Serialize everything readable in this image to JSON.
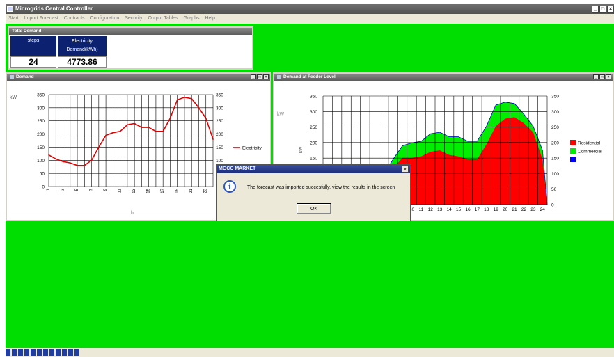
{
  "window": {
    "title": "Microgrids Central Controller",
    "controls": [
      "_",
      "□",
      "×"
    ]
  },
  "menu": [
    "Start",
    "Import Forecast",
    "Contracts",
    "Configuration",
    "Security",
    "Output Tables",
    "Graphs",
    "Help"
  ],
  "total_demand": {
    "title": "Total Demand",
    "col1_header": "steps",
    "col2_header": "Electricity Demand(kWh)",
    "steps_value": "24",
    "demand_value": "4773.86"
  },
  "demand_panel": {
    "title": "Demand",
    "unit_label": "kW",
    "x_label": "h",
    "legend": "Electricity",
    "chart_data": {
      "type": "line",
      "x": [
        1,
        2,
        3,
        4,
        5,
        6,
        7,
        8,
        9,
        10,
        11,
        12,
        13,
        14,
        15,
        16,
        17,
        18,
        19,
        20,
        21,
        22,
        23,
        24
      ],
      "series": [
        {
          "name": "Electricity",
          "values": [
            120,
            105,
            95,
            90,
            80,
            80,
            100,
            150,
            195,
            205,
            210,
            235,
            240,
            225,
            225,
            210,
            210,
            260,
            330,
            340,
            335,
            300,
            260,
            180
          ]
        }
      ],
      "ylim": [
        0,
        350
      ],
      "yticks": [
        0,
        50,
        100,
        150,
        200,
        250,
        300,
        350
      ],
      "xticks": [
        "1",
        "3",
        "5",
        "7",
        "9",
        "11",
        "13",
        "15",
        "17",
        "19",
        "21",
        "23"
      ],
      "grid": true,
      "legend": "right"
    }
  },
  "feeder_panel": {
    "title": "Demand at Feeder Level",
    "unit_label": "kW",
    "legend": [
      "Residential",
      "Commercial",
      ""
    ],
    "colors": {
      "residential": "#ff0000",
      "commercial": "#00ee00",
      "other": "#0000ff"
    },
    "chart_data": {
      "type": "area",
      "x": [
        1,
        2,
        3,
        4,
        5,
        6,
        7,
        8,
        9,
        10,
        11,
        12,
        13,
        14,
        15,
        16,
        17,
        18,
        19,
        20,
        21,
        22,
        23,
        24
      ],
      "series": [
        {
          "name": "Residential",
          "values": [
            80,
            70,
            70,
            65,
            60,
            60,
            80,
            120,
            155,
            155,
            160,
            175,
            180,
            165,
            160,
            150,
            150,
            200,
            260,
            285,
            290,
            270,
            240,
            150
          ]
        },
        {
          "name": "Commercial",
          "values": [
            105,
            95,
            90,
            85,
            80,
            80,
            100,
            150,
            195,
            205,
            210,
            235,
            240,
            225,
            225,
            210,
            210,
            260,
            330,
            340,
            335,
            300,
            260,
            180
          ]
        },
        {
          "name": "",
          "values": []
        }
      ],
      "ylim": [
        0,
        360
      ],
      "left_yticks": [
        0,
        50,
        100,
        150,
        200,
        250,
        300,
        360
      ],
      "right_yticks": [
        0,
        50,
        100,
        150,
        200,
        250,
        300,
        350
      ],
      "xticks": [
        "1",
        "2",
        "3",
        "4",
        "5",
        "6",
        "7",
        "8",
        "9",
        "10",
        "11",
        "12",
        "13",
        "14",
        "15",
        "16",
        "17",
        "18",
        "19",
        "20",
        "21",
        "22",
        "23",
        "24"
      ],
      "grid": true,
      "legend": "right"
    }
  },
  "dialog": {
    "title": "MGCC MARKET",
    "message": "The forecast was imported succesfully, view the results in the screen",
    "ok": "OK",
    "close": "×",
    "icon": "i"
  }
}
